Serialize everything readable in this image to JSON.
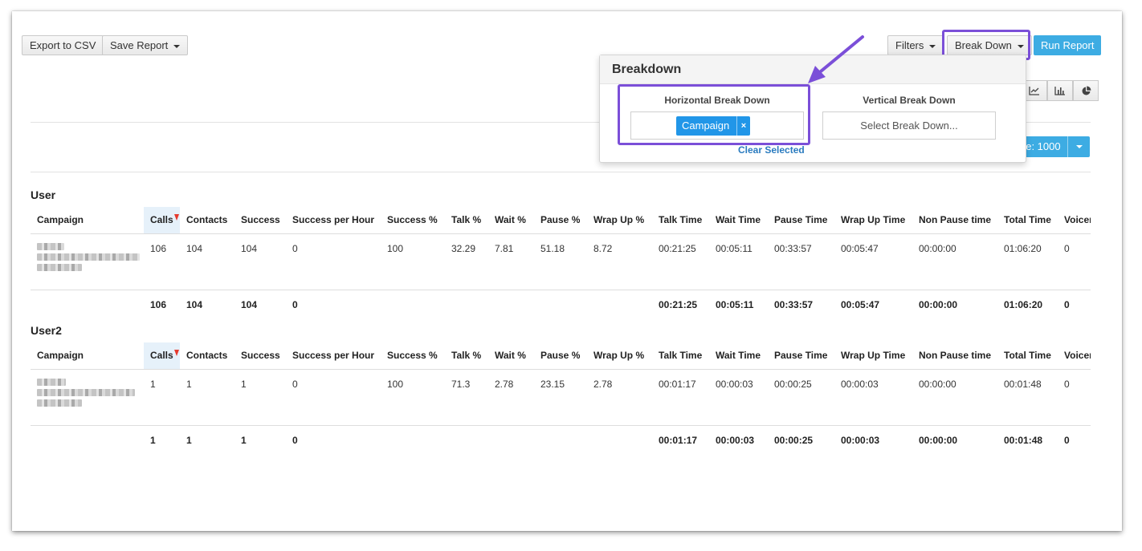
{
  "toolbar": {
    "export_label": "Export to CSV",
    "save_report_label": "Save Report",
    "filters_label": "Filters",
    "breakdown_label": "Break Down",
    "run_report_label": "Run Report"
  },
  "chart_icons": [
    "line-chart-icon",
    "bar-chart-icon",
    "pie-chart-icon"
  ],
  "per_page": {
    "label": "ge: 1000"
  },
  "breakdown_panel": {
    "title": "Breakdown",
    "horizontal_label": "Horizontal Break Down",
    "horizontal_selected": "Campaign",
    "remove_symbol": "×",
    "vertical_label": "Vertical Break Down",
    "vertical_placeholder": "Select Break Down...",
    "clear_label": "Clear Selected"
  },
  "columns": [
    "Campaign",
    "Calls",
    "Contacts",
    "Success",
    "Success per Hour",
    "Success %",
    "Talk %",
    "Wait %",
    "Pause %",
    "Wrap Up %",
    "Talk Time",
    "Wait Time",
    "Pause Time",
    "Wrap Up Time",
    "Non Pause time",
    "Total Time",
    "Voicer"
  ],
  "groups": [
    {
      "title": "User",
      "row": [
        "",
        "106",
        "104",
        "104",
        "0",
        "100",
        "32.29",
        "7.81",
        "51.18",
        "8.72",
        "00:21:25",
        "00:05:11",
        "00:33:57",
        "00:05:47",
        "00:00:00",
        "01:06:20",
        "0"
      ],
      "total": [
        "",
        "106",
        "104",
        "104",
        "0",
        "",
        "",
        "",
        "",
        "",
        "00:21:25",
        "00:05:11",
        "00:33:57",
        "00:05:47",
        "00:00:00",
        "01:06:20",
        "0"
      ]
    },
    {
      "title": "User2",
      "row": [
        "",
        "1",
        "1",
        "1",
        "0",
        "100",
        "71.3",
        "2.78",
        "23.15",
        "2.78",
        "00:01:17",
        "00:00:03",
        "00:00:25",
        "00:00:03",
        "00:00:00",
        "00:01:48",
        "0"
      ],
      "total": [
        "",
        "1",
        "1",
        "1",
        "0",
        "",
        "",
        "",
        "",
        "",
        "00:01:17",
        "00:00:03",
        "00:00:25",
        "00:00:03",
        "00:00:00",
        "00:01:48",
        "0"
      ]
    }
  ],
  "colors": {
    "accent": "#3dace3",
    "highlight": "#7b4fd8",
    "tag": "#2196e8"
  }
}
